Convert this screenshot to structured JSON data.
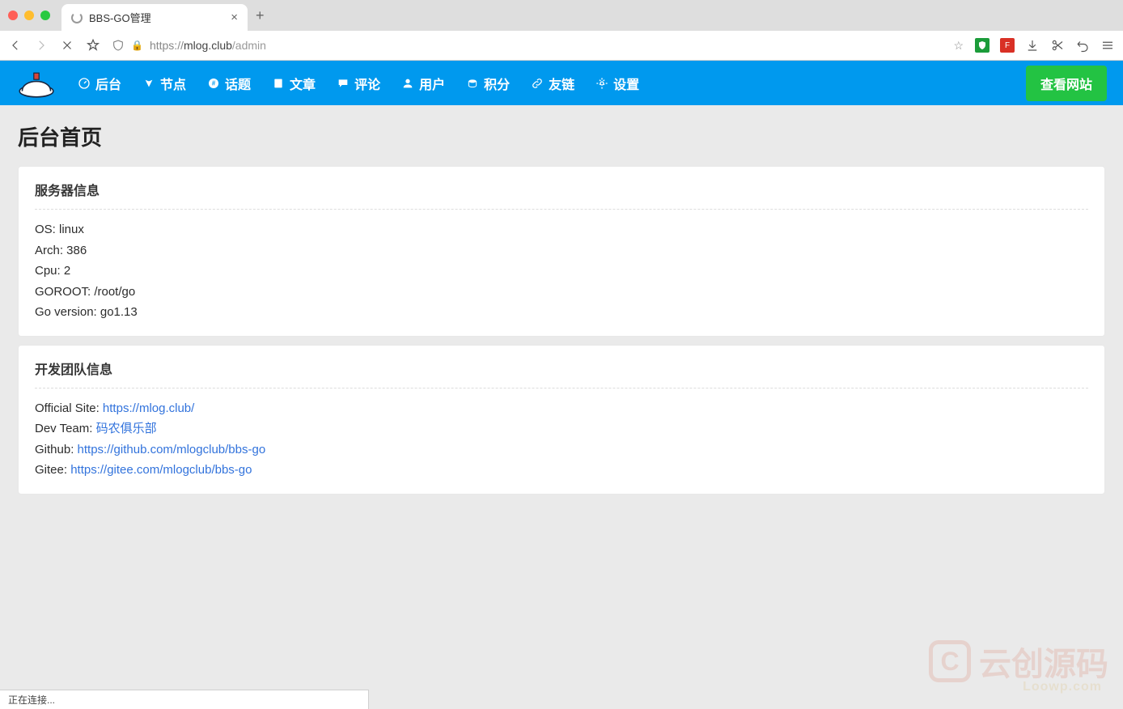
{
  "browser": {
    "tab_title": "BBS-GO管理",
    "newtab_symbol": "+",
    "url_prefix": "https://",
    "url_domain": "mlog.club",
    "url_path": "/admin"
  },
  "nav": {
    "items": [
      "后台",
      "节点",
      "话题",
      "文章",
      "评论",
      "用户",
      "积分",
      "友链",
      "设置"
    ],
    "view_site": "查看网站"
  },
  "page": {
    "title": "后台首页",
    "section1_title": "服务器信息",
    "server_info": [
      "OS: linux",
      "Arch: 386",
      "Cpu: 2",
      "GOROOT: /root/go",
      "Go version: go1.13"
    ],
    "section2_title": "开发团队信息",
    "team_info": [
      {
        "label": "Official Site: ",
        "link": "https://mlog.club/"
      },
      {
        "label": "Dev Team: ",
        "link": "码农俱乐部"
      },
      {
        "label": "Github: ",
        "link": "https://github.com/mlogclub/bbs-go"
      },
      {
        "label": "Gitee: ",
        "link": "https://gitee.com/mlogclub/bbs-go"
      }
    ]
  },
  "status_bar": "正在连接...",
  "watermark": {
    "main": "云创源码",
    "sub": "Loowp.com"
  }
}
